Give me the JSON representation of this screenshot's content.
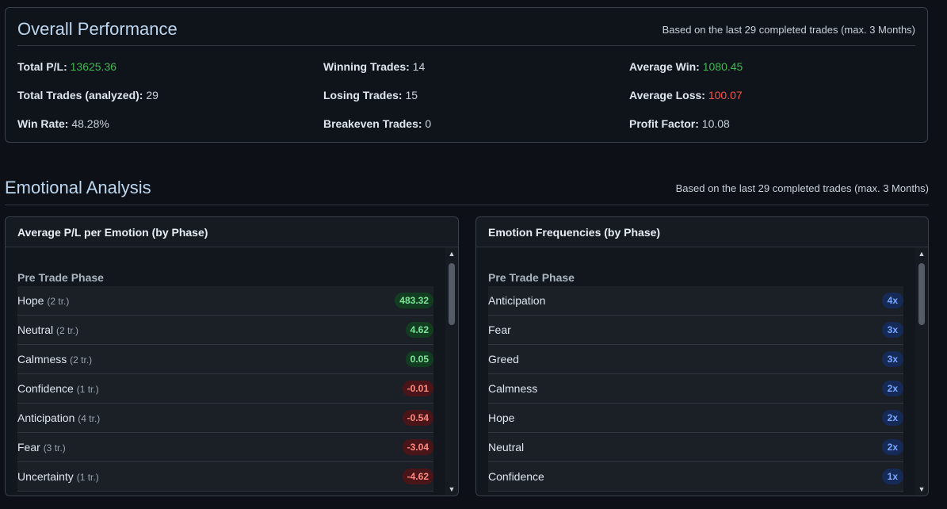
{
  "overall": {
    "title": "Overall Performance",
    "note": "Based on the last 29 completed trades (max. 3 Months)",
    "stats": {
      "total_pl": {
        "label": "Total P/L:",
        "value": "13625.36"
      },
      "total_trades": {
        "label": "Total Trades (analyzed):",
        "value": "29"
      },
      "win_rate": {
        "label": "Win Rate:",
        "value": "48.28%"
      },
      "winning": {
        "label": "Winning Trades:",
        "value": "14"
      },
      "losing": {
        "label": "Losing Trades:",
        "value": "15"
      },
      "breakeven": {
        "label": "Breakeven Trades:",
        "value": "0"
      },
      "avg_win": {
        "label": "Average Win:",
        "value": "1080.45"
      },
      "avg_loss": {
        "label": "Average Loss:",
        "value": "100.07"
      },
      "profit_factor": {
        "label": "Profit Factor:",
        "value": "10.08"
      }
    }
  },
  "emotional": {
    "title": "Emotional Analysis",
    "note": "Based on the last 29 completed trades (max. 3 Months)",
    "avg_panel": {
      "title": "Average P/L per Emotion (by Phase)",
      "phase": "Pre Trade Phase",
      "rows": [
        {
          "name": "Hope",
          "trades": "(2 tr.)",
          "value": "483.32"
        },
        {
          "name": "Neutral",
          "trades": "(2 tr.)",
          "value": "4.62"
        },
        {
          "name": "Calmness",
          "trades": "(2 tr.)",
          "value": "0.05"
        },
        {
          "name": "Confidence",
          "trades": "(1 tr.)",
          "value": "-0.01"
        },
        {
          "name": "Anticipation",
          "trades": "(4 tr.)",
          "value": "-0.54"
        },
        {
          "name": "Fear",
          "trades": "(3 tr.)",
          "value": "-3.04"
        },
        {
          "name": "Uncertainty",
          "trades": "(1 tr.)",
          "value": "-4.62"
        }
      ]
    },
    "freq_panel": {
      "title": "Emotion Frequencies (by Phase)",
      "phase": "Pre Trade Phase",
      "rows": [
        {
          "name": "Anticipation",
          "count": "4x"
        },
        {
          "name": "Fear",
          "count": "3x"
        },
        {
          "name": "Greed",
          "count": "3x"
        },
        {
          "name": "Calmness",
          "count": "2x"
        },
        {
          "name": "Hope",
          "count": "2x"
        },
        {
          "name": "Neutral",
          "count": "2x"
        },
        {
          "name": "Confidence",
          "count": "1x"
        }
      ]
    }
  },
  "icons": {
    "scroll_up": "▲",
    "scroll_down": "▼"
  }
}
